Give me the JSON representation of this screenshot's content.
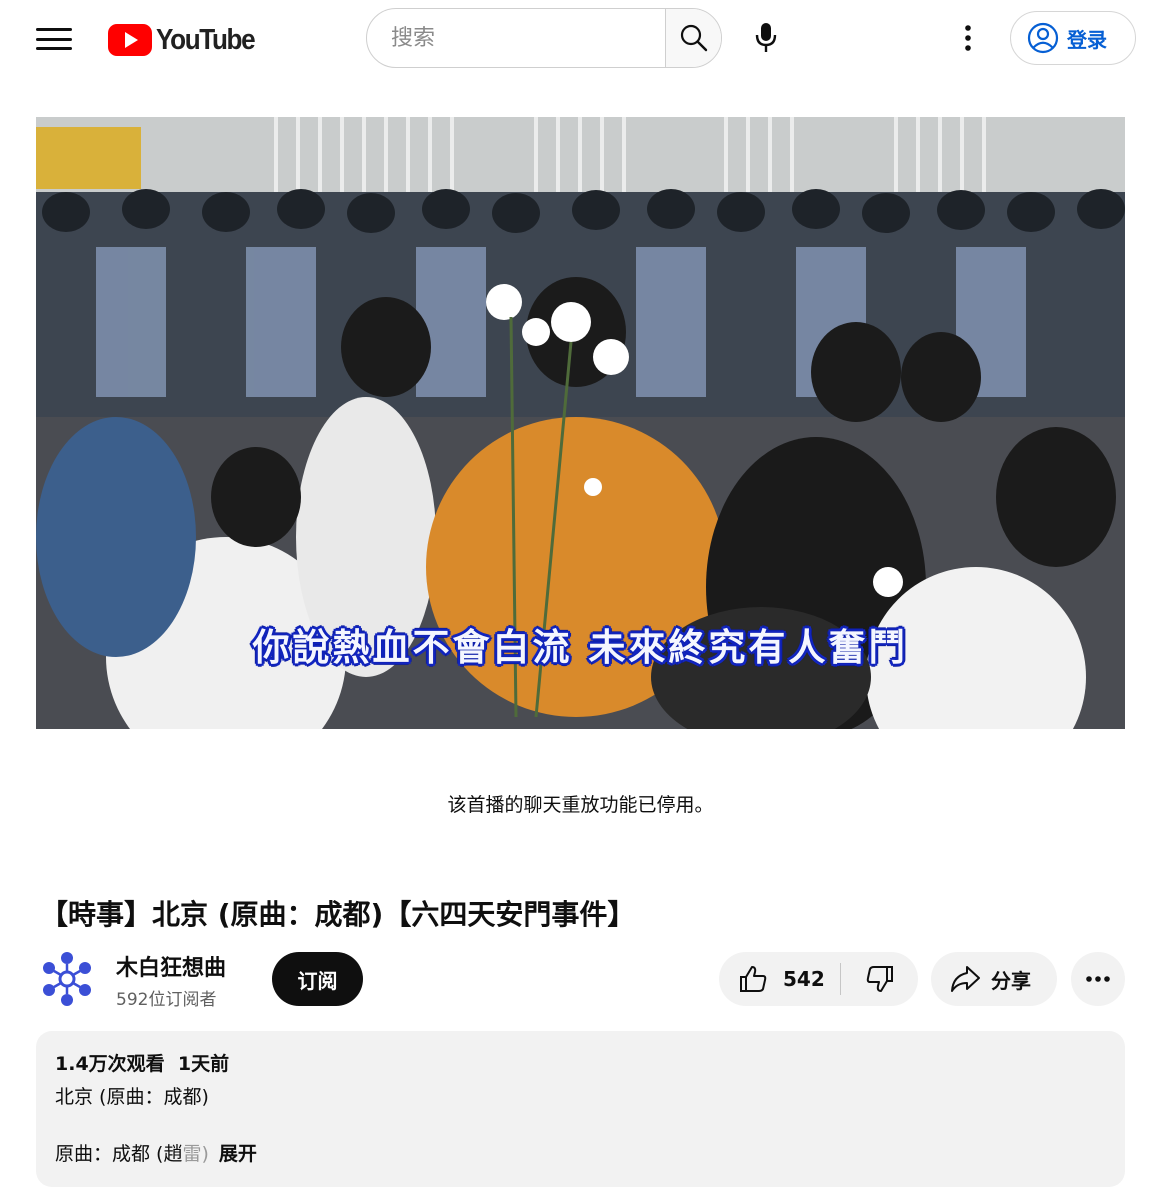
{
  "header": {
    "logo_text": "YouTube",
    "search_placeholder": "搜索",
    "signin_label": "登录"
  },
  "player": {
    "subtitle": "你說熱血不會白流 未來終究有人奮鬥"
  },
  "chat_replay_notice": "该首播的聊天重放功能已停用。",
  "video": {
    "title": "【時事】北京 (原曲：成都)【六四天安門事件】"
  },
  "channel": {
    "name": "木白狂想曲",
    "subscribers": "592位订阅者",
    "subscribe_label": "订阅"
  },
  "actions": {
    "like_count": "542",
    "share_label": "分享"
  },
  "description": {
    "views": "1.4万次观看",
    "age": "1天前",
    "line1": "北京 (原曲：成都)",
    "line2_visible": "原曲：成都 (趙",
    "line2_faded": "雷)",
    "expand_label": "展开"
  },
  "colors": {
    "brand_red": "#ff0000",
    "link_blue": "#065fd4",
    "subscribe_bg": "#0f0f0f",
    "pill_bg": "#f2f2f2"
  },
  "icons": {
    "menu": "hamburger-menu-icon",
    "search": "search-icon",
    "mic": "microphone-icon",
    "more": "vertical-dots-icon",
    "account": "account-circle-icon",
    "like": "thumbs-up-icon",
    "dislike": "thumbs-down-icon",
    "share": "share-arrow-icon",
    "actions_more": "horizontal-dots-icon"
  }
}
